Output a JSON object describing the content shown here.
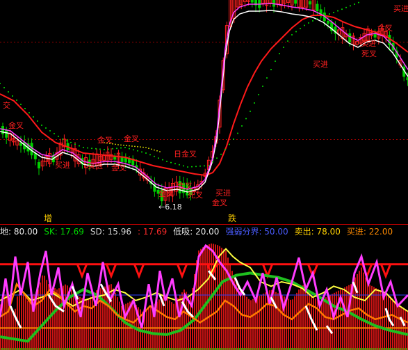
{
  "info_bar": {
    "items": [
      {
        "label": "地",
        "sep": ": ",
        "value": "80.00",
        "color": "#e8e8e8"
      },
      {
        "label": "SK",
        "sep": ": ",
        "value": "17.69",
        "color": "#00d800"
      },
      {
        "label": "SD",
        "sep": ": ",
        "value": "15.96",
        "color": "#d6d6d6"
      },
      {
        "label": "",
        "sep": ": ",
        "value": "17.69",
        "color": "#ff2a2a"
      },
      {
        "label": "低吸",
        "sep": ": ",
        "value": "20.00",
        "color": "#e8e8e8"
      },
      {
        "label": "强弱分界",
        "sep": ": ",
        "value": "50.00",
        "color": "#4a5cff"
      },
      {
        "label": "卖出",
        "sep": ": ",
        "value": "78.00",
        "color": "#ffd000"
      },
      {
        "label": "买进",
        "sep": ": ",
        "value": "22.00",
        "color": "#ff8a00"
      }
    ]
  },
  "colors": {
    "up": "#ff2020",
    "down": "#00d000",
    "ma_red": "#ff1a1a",
    "ma_magenta": "#ff3cff",
    "ma_white": "#ffffff",
    "dots": "#00e000",
    "dots_yellow": "#e8e800",
    "sk_green": "#1fbf1f",
    "sd_white": "#ffffff",
    "line_yellow": "#ffff40",
    "line_orange": "#ff7a00",
    "line_magenta": "#ff3cff",
    "hline_blue": "#3040ff",
    "hline_red": "#ff1010",
    "hline_orange": "#ff8a00"
  },
  "chart_data": [
    {
      "type": "candlestick",
      "price_labels": [
        {
          "text": "6.18",
          "arrow": "←"
        }
      ],
      "markers": [
        {
          "text": "增",
          "kind": "bottom-label"
        },
        {
          "text": "跌",
          "kind": "bottom-label"
        }
      ],
      "signal_labels": [
        {
          "text": "买进",
          "x": 566,
          "y": 16
        },
        {
          "text": "金叉",
          "x": 543,
          "y": 44
        },
        {
          "text": "买进",
          "x": 519,
          "y": 66
        },
        {
          "text": "死叉",
          "x": 520,
          "y": 81
        },
        {
          "text": "买进",
          "x": 450,
          "y": 96
        },
        {
          "text": "金叉",
          "x": 12,
          "y": 184
        },
        {
          "text": "金叉",
          "x": 140,
          "y": 205
        },
        {
          "text": "金叉",
          "x": 178,
          "y": 203
        },
        {
          "text": "买进",
          "x": 79,
          "y": 241
        },
        {
          "text": "买进",
          "x": 126,
          "y": 242
        },
        {
          "text": "金叉",
          "x": 160,
          "y": 245
        },
        {
          "text": "日金叉",
          "x": 250,
          "y": 225
        },
        {
          "text": "金叉",
          "x": 255,
          "y": 271
        },
        {
          "text": "死叉",
          "x": 270,
          "y": 284
        },
        {
          "text": "买进",
          "x": 310,
          "y": 281
        },
        {
          "text": "金叉",
          "x": 305,
          "y": 295
        },
        {
          "text": "金叉",
          "x": 228,
          "y": 282
        },
        {
          "text": "交",
          "x": 4,
          "y": 155
        }
      ]
    },
    {
      "type": "oscillator",
      "ylim": [
        0,
        100
      ],
      "hlines": [
        {
          "name": "卖出",
          "value": 78
        },
        {
          "name": "强弱分界",
          "value": 50
        },
        {
          "name": "低吸",
          "value": 20
        }
      ]
    }
  ]
}
